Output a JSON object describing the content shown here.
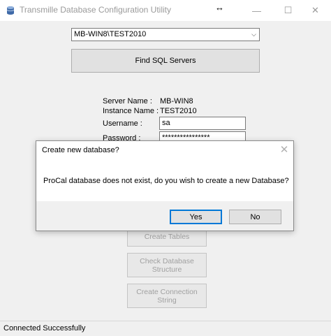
{
  "window": {
    "title": "Transmille Database Configuration Utility",
    "resize_cursor": "↔",
    "minimize_glyph": "—",
    "maximize_glyph": "☐",
    "close_glyph": "✕"
  },
  "server": {
    "selected": "MB-WIN8\\TEST2010",
    "dropdown_glyph": "⌵"
  },
  "find_button": {
    "label": "Find SQL Servers"
  },
  "info": {
    "server_name_label": "Server Name :",
    "server_name_value": "MB-WIN8",
    "instance_name_label": "Instance Name :",
    "instance_name_value": "TEST2010",
    "username_label": "Username :",
    "username_value": "sa",
    "password_label": "Password :",
    "password_value": "****************"
  },
  "actions": {
    "create_tables": "Create Tables",
    "check_structure_line1": "Check Database",
    "check_structure_line2": "Structure",
    "create_connection_line1": "Create Connection",
    "create_connection_line2": "String"
  },
  "status": {
    "text": "Connected Successfully"
  },
  "dialog": {
    "title": "Create new database?",
    "close_glyph": "✕",
    "message": "ProCal database does not exist, do you wish to create a new Database?",
    "yes_label": "Yes",
    "no_label": "No"
  },
  "colors": {
    "focus_accent": "#0078d7",
    "disabled_text": "#a0a0a0"
  }
}
